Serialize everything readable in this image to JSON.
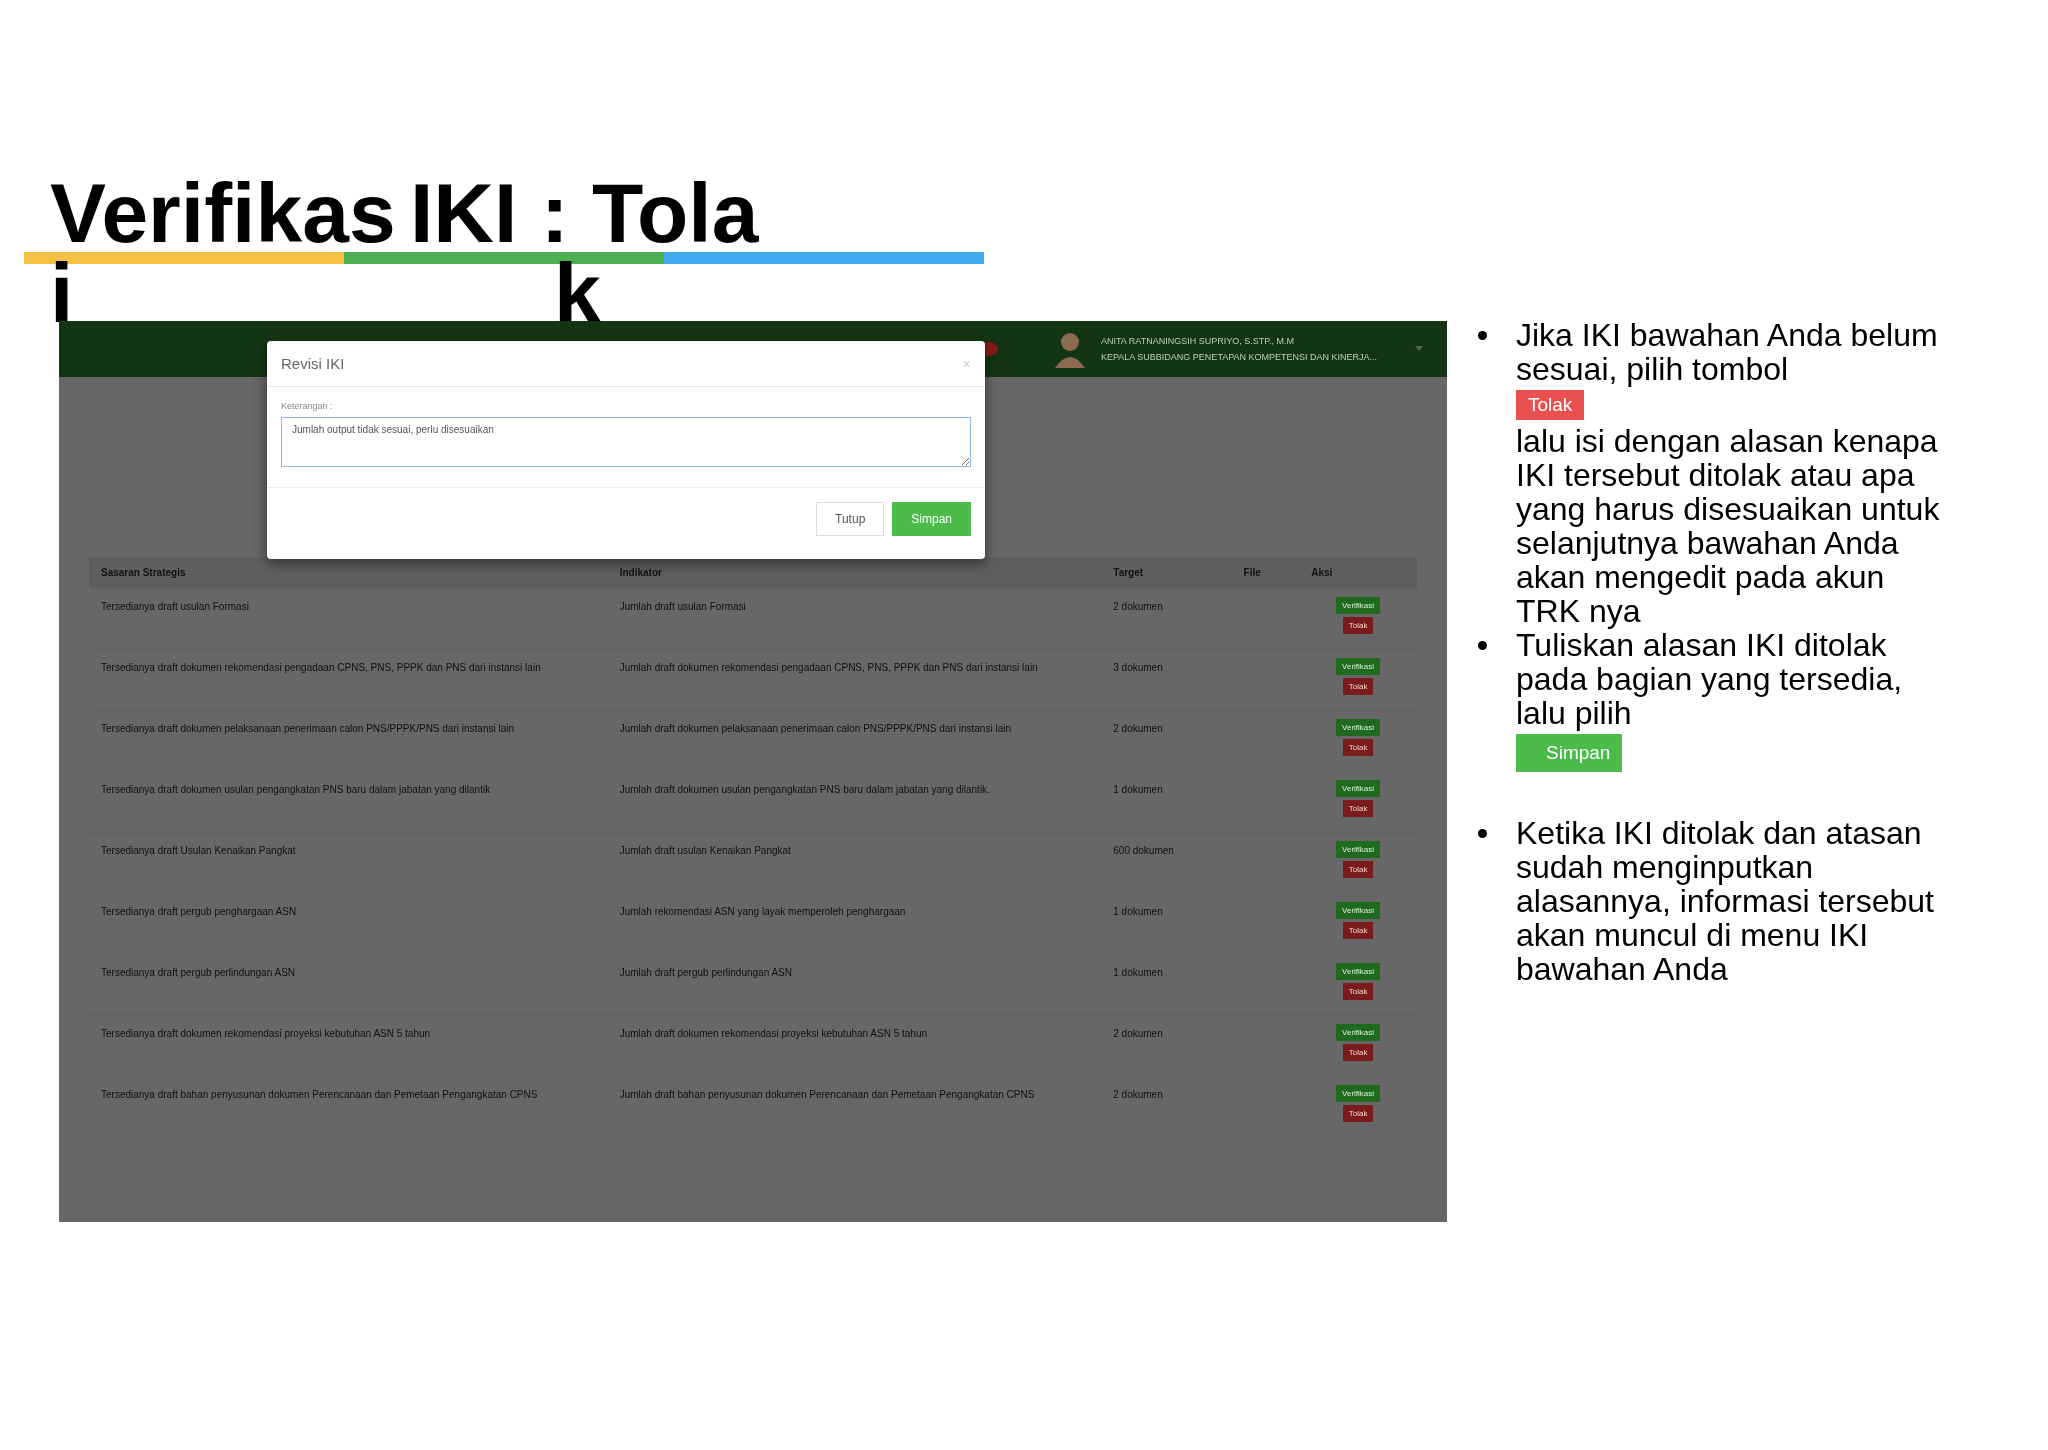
{
  "slide_title": {
    "part_1": "Verifikas",
    "part_1_end": "i",
    "part_2": "IKI : Tola",
    "part_2_end": "k"
  },
  "screen": {
    "header": {
      "user_name": "ANITA RATNANINGSIH SUPRIYO, S.STP., M.M",
      "user_role": "KEPALA SUBBIDANG PENETAPAN KOMPETENSI DAN KINERJA..."
    },
    "table": {
      "columns": [
        "Sasaran Strategis",
        "Indikator",
        "Target",
        "File",
        "Aksi"
      ],
      "rows": [
        {
          "goal": "Tersedianya draft usulan Formasi",
          "indicator": "Jumlah draft usulan Formasi",
          "target": "2 dokumen",
          "verify": "Verifikasi",
          "reject": "Tolak"
        },
        {
          "goal": "Tersedianya draft dokumen rekomendasi pengadaan CPNS, PNS, PPPK dan PNS dari instansi lain",
          "indicator": "Jumlah draft dokumen rekomendasi pengadaan CPNS, PNS, PPPK dan PNS dari instansi lain",
          "target": "3 dokumen",
          "verify": "Verifikasi",
          "reject": "Tolak"
        },
        {
          "goal": "Tersedianya draft dokumen pelaksanaan penerimaan calon PNS/PPPK/PNS dari instansi lain",
          "indicator": "Jumlah draft dokumen pelaksanaan penerimaan calon PNS/PPPK/PNS dari instansi lain",
          "target": "2 dokumen",
          "verify": "Verifikasi",
          "reject": "Tolak"
        },
        {
          "goal": "Tersedianya draft dokumen usulan pengangkatan PNS baru dalam jabatan yang dilantik",
          "indicator": "Jumlah draft dokumen usulan pengangkatan PNS baru dalam jabatan yang dilantik.",
          "target": "1 dokumen",
          "verify": "Verifikasi",
          "reject": "Tolak"
        },
        {
          "goal": "Tersedianya draft Usulan Kenaikan Pangkat",
          "indicator": "Jumlah draft usulan Kenaikan Pangkat",
          "target": "600 dokumen",
          "verify": "Verifikasi",
          "reject": "Tolak"
        },
        {
          "goal": "Tersedianya draft pergub penghargaan ASN",
          "indicator": "Jumlah rekomendasi ASN yang layak memperoleh penghargaan",
          "target": "1 dokumen",
          "verify": "Verifikasi",
          "reject": "Tolak"
        },
        {
          "goal": "Tersedianya draft pergub perlindungan ASN",
          "indicator": "Jumlah draft pergub perlindungan ASN",
          "target": "1 dokumen",
          "verify": "Verifikasi",
          "reject": "Tolak"
        },
        {
          "goal": "Tersedianya draft dokumen rekomendasi proyeksi kebutuhan ASN 5 tahun",
          "indicator": "Jumlah draft dokumen rekomendasi proyeksi kebutuhan ASN 5 tahun",
          "target": "2 dokumen",
          "verify": "Verifikasi",
          "reject": "Tolak"
        },
        {
          "goal": "Tersedianya draft bahan penyusunan dokumen Perencanaan dan Pemetaan Pengangkatan CPNS",
          "indicator": "Jumlah draft bahan penyusunan dokumen Perencanaan dan Pemetaan Pengangkatan CPNS",
          "target": "2 dokumen",
          "verify": "Verifikasi",
          "reject": "Tolak"
        }
      ]
    },
    "dialog": {
      "title": "Revisi IKI",
      "close": "×",
      "field_label": "Keterangan :",
      "field_value": "Jumlah output tidak sesuai, perlu disesuaikan",
      "buttons": [
        {
          "label": "Tutup",
          "kind": "secondary"
        },
        {
          "label": "Simpan",
          "kind": "primary"
        }
      ]
    }
  },
  "bullets": [
    {
      "text_before": "Jika IKI bawahan Anda belum sesuai, pilih tombol",
      "button": {
        "label": "Tolak",
        "kind": "danger"
      },
      "text_after": "lalu isi dengan alasan kenapa IKI tersebut ditolak atau apa yang harus disesuaikan untuk selanjutnya bawahan Anda akan mengedit pada akun TRK nya"
    },
    {
      "text_before": "Tuliskan alasan IKI ditolak pada bagian yang tersedia, lalu pilih",
      "button": {
        "label": "Simpan",
        "kind": "primary"
      }
    },
    {
      "text_before": "Ketika IKI ditolak dan atasan sudah menginputkan alasannya, informasi tersebut akan muncul di menu IKI bawahan Anda"
    }
  ]
}
